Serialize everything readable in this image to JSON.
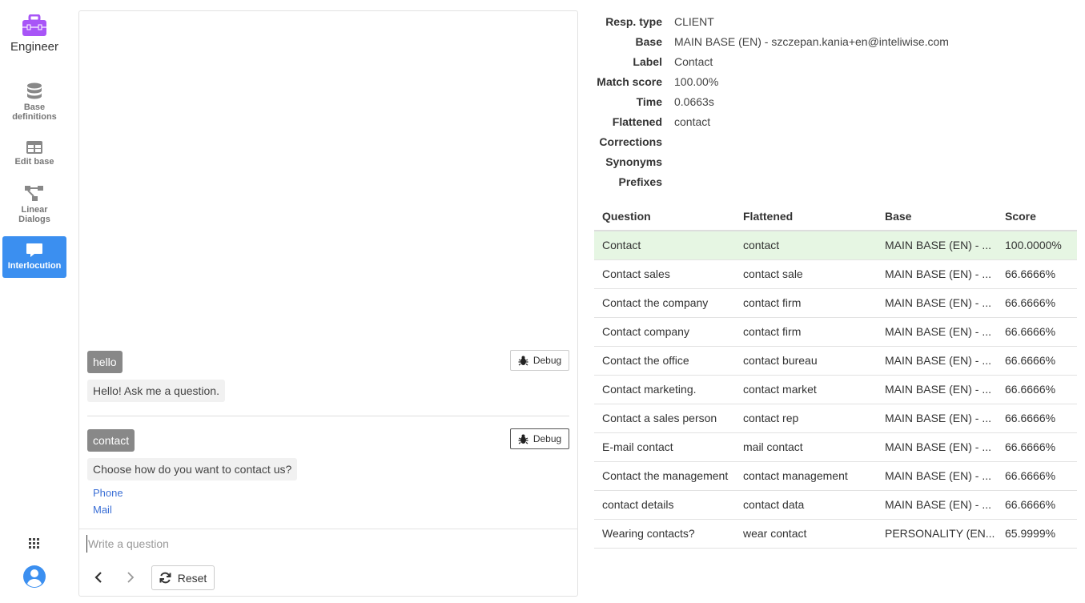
{
  "sidebar": {
    "brand": "Engineer",
    "items": [
      {
        "label_line1": "Base",
        "label_line2": "definitions",
        "icon": "database-icon"
      },
      {
        "label_line1": "Edit base",
        "label_line2": "",
        "icon": "table-icon"
      },
      {
        "label_line1": "Linear",
        "label_line2": "Dialogs",
        "icon": "flow-icon"
      },
      {
        "label_line1": "Interlocution",
        "label_line2": "",
        "icon": "chat-icon"
      }
    ],
    "accent": "#3b8ff0",
    "brand_color": "#a855f7"
  },
  "chat": {
    "messages": [
      {
        "user": "hello",
        "bot": "Hello! Ask me a question.",
        "debug_label": "Debug"
      },
      {
        "user": "contact",
        "bot": "Choose how do you want to contact us?",
        "debug_label": "Debug",
        "links": [
          "Phone",
          "Mail"
        ]
      }
    ],
    "input_placeholder": "Write a question",
    "reset_label": "Reset"
  },
  "details": {
    "fields": [
      {
        "key": "Resp. type",
        "value": "CLIENT"
      },
      {
        "key": "Base",
        "value": "MAIN BASE (EN) - szczepan.kania+en@inteliwise.com"
      },
      {
        "key": "Label",
        "value": "Contact"
      },
      {
        "key": "Match score",
        "value": "100.00%"
      },
      {
        "key": "Time",
        "value": "0.0663s"
      },
      {
        "key": "Flattened",
        "value": "contact"
      },
      {
        "key": "Corrections",
        "value": ""
      },
      {
        "key": "Synonyms",
        "value": ""
      },
      {
        "key": "Prefixes",
        "value": ""
      }
    ],
    "table": {
      "headers": [
        "Question",
        "Flattened",
        "Base",
        "Score"
      ],
      "rows": [
        [
          "Contact",
          "contact",
          "MAIN BASE (EN) - ...",
          "100.0000%"
        ],
        [
          "Contact sales",
          "contact sale",
          "MAIN BASE (EN) - ...",
          "66.6666%"
        ],
        [
          "Contact the company",
          "contact firm",
          "MAIN BASE (EN) - ...",
          "66.6666%"
        ],
        [
          "Contact company",
          "contact firm",
          "MAIN BASE (EN) - ...",
          "66.6666%"
        ],
        [
          "Contact the office",
          "contact bureau",
          "MAIN BASE (EN) - ...",
          "66.6666%"
        ],
        [
          "Contact marketing.",
          "contact market",
          "MAIN BASE (EN) - ...",
          "66.6666%"
        ],
        [
          "Contact a sales person",
          "contact rep",
          "MAIN BASE (EN) - ...",
          "66.6666%"
        ],
        [
          "E-mail contact",
          "mail contact",
          "MAIN BASE (EN) - ...",
          "66.6666%"
        ],
        [
          "Contact the management",
          "contact management",
          "MAIN BASE (EN) - ...",
          "66.6666%"
        ],
        [
          "contact details",
          "contact data",
          "MAIN BASE (EN) - ...",
          "66.6666%"
        ],
        [
          "Wearing contacts?",
          "wear contact",
          "PERSONALITY (EN...",
          "65.9999%"
        ]
      ]
    }
  }
}
